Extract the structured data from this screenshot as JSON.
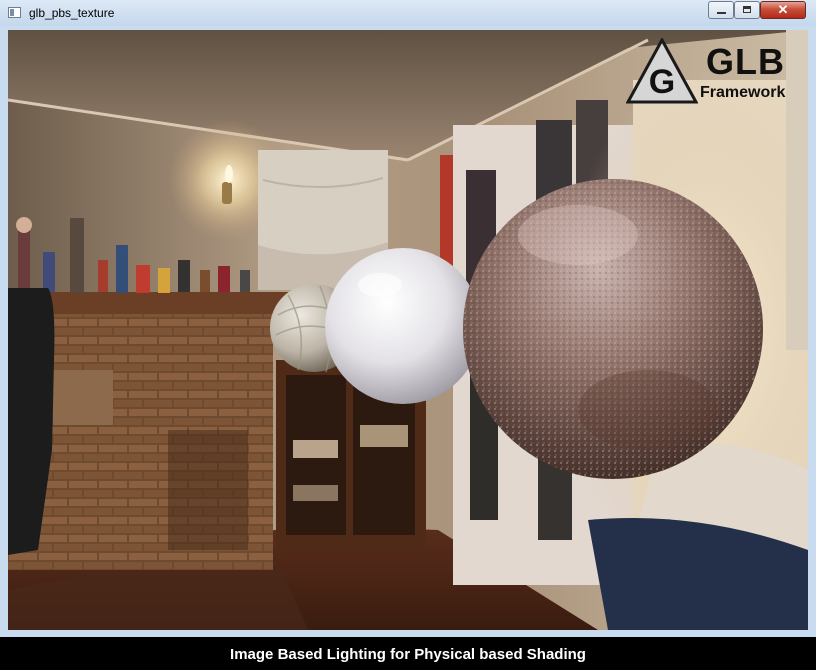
{
  "window": {
    "title": "glb_pbs_texture",
    "controls": {
      "minimize": "minimize",
      "maximize": "maximize",
      "close": "✕"
    }
  },
  "logo": {
    "title": "GLB",
    "subtitle": "Framework",
    "icon": "g-triangle-icon"
  },
  "footer": {
    "caption": "Image Based Lighting for Physical based Shading"
  },
  "scene": {
    "spheres": [
      {
        "name": "patterned-marble-sphere",
        "color": "#cfc8bc"
      },
      {
        "name": "white-glossy-sphere",
        "color": "#e8e6ea"
      },
      {
        "name": "rusted-metal-sphere",
        "color": "#8a6e66"
      }
    ]
  }
}
